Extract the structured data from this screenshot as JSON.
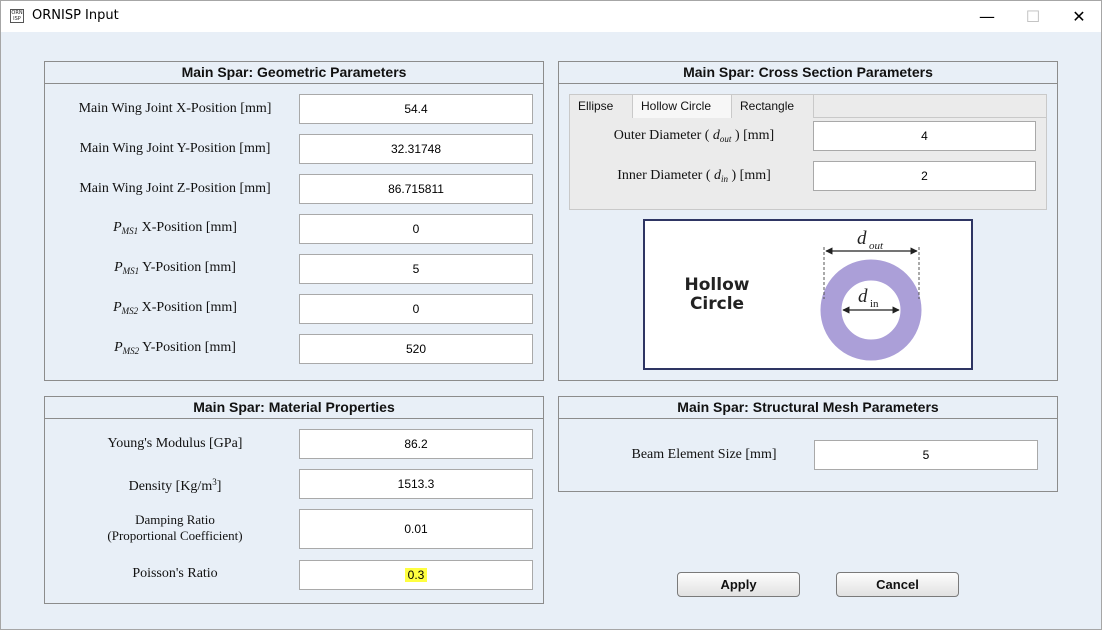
{
  "window": {
    "title": "ORNISP Input",
    "icon_text": "ORN ISP",
    "minimize_glyph": "—",
    "maximize_glyph": "☐",
    "close_glyph": "✕"
  },
  "geometric": {
    "title": "Main Spar: Geometric Parameters",
    "rows": [
      {
        "label": "Main Wing Joint X-Position [mm]",
        "value": "54.4"
      },
      {
        "label": "Main Wing Joint Y-Position [mm]",
        "value": "32.31748"
      },
      {
        "label": "Main Wing Joint Z-Position [mm]",
        "value": "86.715811"
      },
      {
        "p": "P",
        "sub": "MS1",
        "rest": " X-Position [mm]",
        "value": "0"
      },
      {
        "p": "P",
        "sub": "MS1",
        "rest": " Y-Position [mm]",
        "value": "5"
      },
      {
        "p": "P",
        "sub": "MS2",
        "rest": " X-Position [mm]",
        "value": "0"
      },
      {
        "p": "P",
        "sub": "MS2",
        "rest": " Y-Position [mm]",
        "value": "520"
      }
    ]
  },
  "cross_section": {
    "title": "Main Spar: Cross Section Parameters",
    "tabs": [
      "Ellipse",
      "Hollow Circle",
      "Rectangle"
    ],
    "outer": {
      "pre": "Outer Diameter ( ",
      "sym": "d",
      "sub": "out",
      "post": " ) [mm]",
      "value": "4"
    },
    "inner": {
      "pre": "Inner Diameter ( ",
      "sym": "d",
      "sub": "in",
      "post": " ) [mm]",
      "value": "2"
    },
    "diagram": {
      "caption_line1": "Hollow",
      "caption_line2": "Circle",
      "outer_sym": "d",
      "outer_sub": "out",
      "inner_sym": "d",
      "inner_sub": "in",
      "ring_color": "#ab9fd8"
    }
  },
  "material": {
    "title": "Main Spar: Material Properties",
    "youngs": {
      "label": "Young's Modulus [GPa]",
      "value": "86.2"
    },
    "density": {
      "label": "Density [Kg/m",
      "sup": "3",
      "label_end": "]",
      "value": "1513.3"
    },
    "damping": {
      "line1": "Damping Ratio",
      "line2": "(Proportional Coefficient)",
      "value": "0.01"
    },
    "poisson": {
      "label": "Poisson's Ratio",
      "value": "0.3"
    }
  },
  "mesh": {
    "title": "Main Spar: Structural Mesh Parameters",
    "beam": {
      "label": "Beam Element Size [mm]",
      "value": "5"
    }
  },
  "buttons": {
    "apply": "Apply",
    "cancel": "Cancel"
  },
  "colors": {
    "window_bg": "#e8eff7",
    "diagram_border": "#2e3563",
    "highlight": "#ffff40"
  }
}
